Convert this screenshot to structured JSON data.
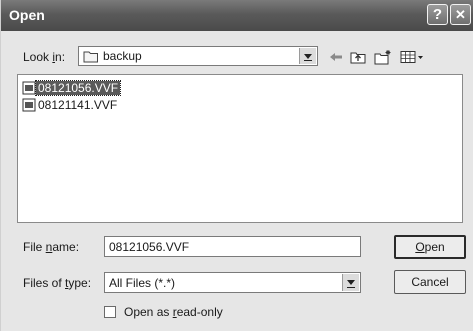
{
  "window": {
    "title": "Open"
  },
  "titlebar_buttons": {
    "help": "?",
    "close": "✕"
  },
  "lookin": {
    "label_pre": "Look ",
    "label_key": "i",
    "label_post": "n:",
    "value": "backup"
  },
  "toolbar": {
    "icons": [
      "back-arrow-icon",
      "up-folder-icon",
      "new-folder-icon",
      "view-menu-icon"
    ]
  },
  "files": [
    {
      "name": "08121056.VVF",
      "selected": true
    },
    {
      "name": "08121141.VVF",
      "selected": false
    }
  ],
  "filename": {
    "label_pre": "File ",
    "label_key": "n",
    "label_post": "ame:",
    "value": "08121056.VVF"
  },
  "filetype": {
    "label_pre": "Files of ",
    "label_key": "t",
    "label_post": "ype:",
    "value": "All Files (*.*)"
  },
  "buttons": {
    "open_key": "O",
    "open_rest": "pen",
    "cancel": "Cancel"
  },
  "readonly": {
    "label_pre": "Open as ",
    "label_key": "r",
    "label_post": "ead-only",
    "checked": false
  },
  "colors": {
    "titlebar": "#5a5a5a",
    "selection": "#5a5a5a",
    "window": "#e6e6e6"
  }
}
